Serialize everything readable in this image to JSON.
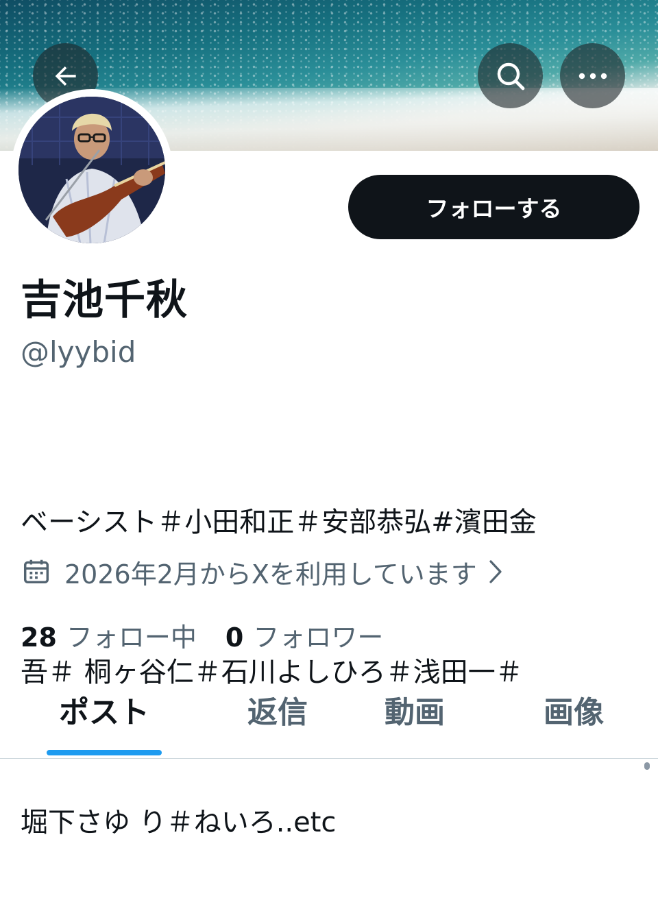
{
  "header": {
    "back_icon": "arrow-left-icon",
    "search_icon": "search-icon",
    "more_icon": "more-horizontal-icon"
  },
  "profile": {
    "display_name": "吉池千秋",
    "handle": "@lyybid",
    "follow_button_label": "フォローする",
    "bio_lines": [
      "ベーシスト＃小田和正＃安部恭弘#濱田金",
      "吾＃ 桐ヶ谷仁＃石川よしひろ＃浅田一＃",
      "堀下さゆ り＃ねいろ..etc"
    ],
    "joined": {
      "icon": "calendar-icon",
      "text": "2026年2月からXを利用しています",
      "chevron_icon": "chevron-right-icon"
    },
    "following_count": "28",
    "following_label": "フォロー中",
    "followers_count": "0",
    "followers_label": "フォロワー"
  },
  "tabs": [
    {
      "label": "ポスト",
      "active": true
    },
    {
      "label": "返信",
      "active": false
    },
    {
      "label": "動画",
      "active": false
    },
    {
      "label": "画像",
      "active": false
    }
  ],
  "colors": {
    "accent": "#1d9bf0",
    "text_primary": "#0f1419",
    "text_secondary": "#536471",
    "follow_button_bg": "#0f1419"
  }
}
